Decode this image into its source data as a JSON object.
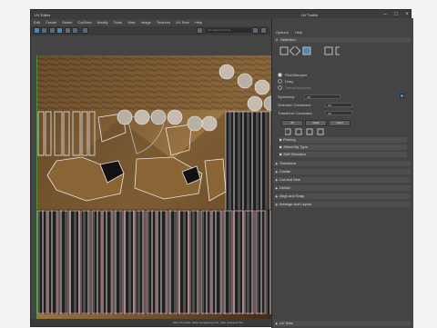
{
  "editor": {
    "title": "UV Editor",
    "menu": [
      "Edit",
      "Create",
      "Select",
      "Cut/Sew",
      "Modify",
      "Tools",
      "View",
      "Image",
      "Textures",
      "UV Sets",
      "Help"
    ],
    "field_placeholder": "Set Selection Pivot",
    "status": "(0/0) UV shells, (0/0) overlapping UVs, (0/0) reversed UVs"
  },
  "toolkit": {
    "title": "UV Toolkit",
    "menu": [
      "Options",
      "Help"
    ],
    "selection_header": "Selection",
    "pick_marquee": "Pick/Marquee",
    "drag": "Drag",
    "tweak_marquee": "Tweak/Marquee",
    "symmetry_label": "Symmetry:",
    "symmetry_value": "Off",
    "selection_constraint_label": "Selection Constraint:",
    "selection_constraint_value": "Off",
    "transform_constraint_label": "Transform Constraint:",
    "transform_constraint_value": "Off",
    "all_btn": "All",
    "clear_btn": "Clear",
    "invert_btn": "Invert",
    "subsections": [
      "Pinning",
      "Select By Type",
      "Soft Selection"
    ],
    "sections": [
      "Transform",
      "Create",
      "Cut and Sew",
      "Unfold",
      "Align and Snap",
      "Arrange and Layout"
    ],
    "uv_sets": "UV Sets"
  },
  "colors": {
    "accent": "#4b88b8",
    "panel_bg": "#444444",
    "uv_wire": "#d8d8d8",
    "uv_shell": "#e8a8a8",
    "wood": "#8a6a3c"
  }
}
